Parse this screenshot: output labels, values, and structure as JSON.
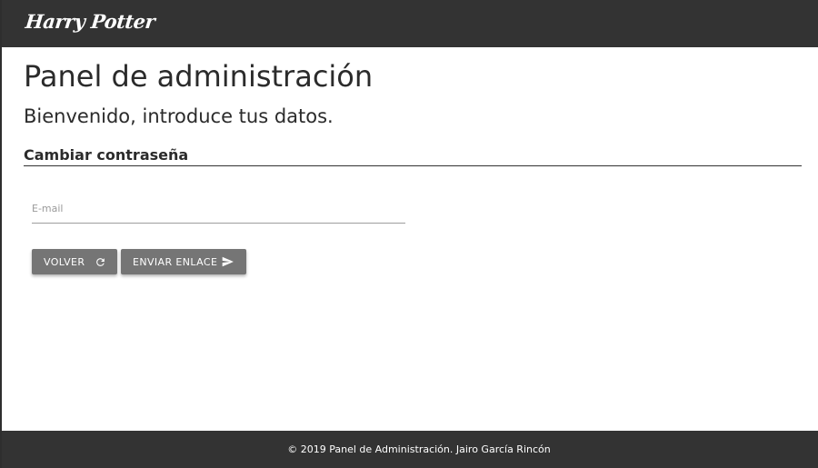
{
  "header": {
    "logo_text": "Harry Potter"
  },
  "main": {
    "title": "Panel de administración",
    "subtitle": "Bienvenido, introduce tus datos.",
    "section_heading": "Cambiar contraseña",
    "email": {
      "placeholder": "E-mail",
      "value": ""
    },
    "buttons": {
      "back_label": "VOLVER",
      "back_icon": "refresh-icon",
      "send_label": "ENVIAR ENLACE",
      "send_icon": "send-icon"
    }
  },
  "footer": {
    "text": "© 2019 Panel de Administración. Jairo García Rincón"
  },
  "colors": {
    "bar_background": "#333333",
    "button_background": "#757575",
    "text": "#2b2b2b"
  }
}
